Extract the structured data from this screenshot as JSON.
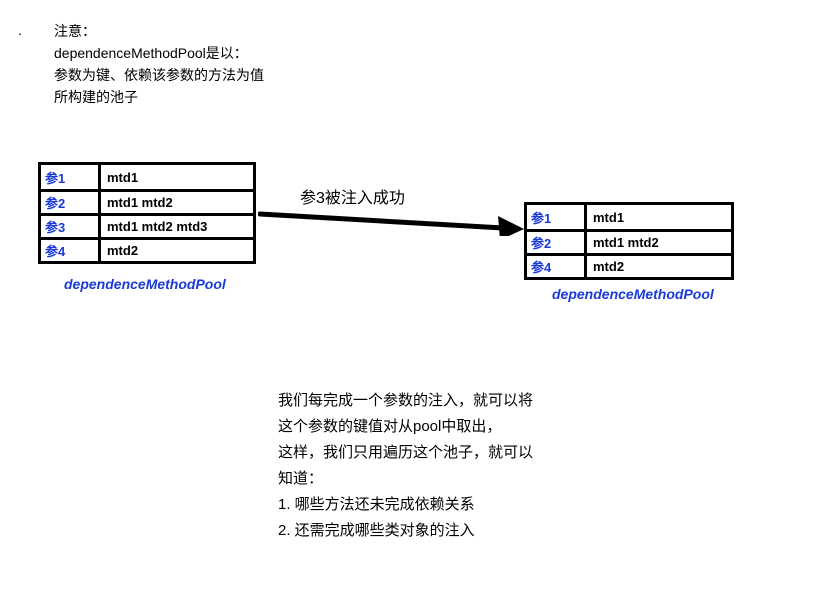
{
  "intro": {
    "line1": "注意：",
    "line2": "dependenceMethodPool是以：",
    "line3": "参数为键、依赖该参数的方法为值",
    "line4": "所构建的池子"
  },
  "leftTable": {
    "rows": [
      {
        "key": "参1",
        "val": "mtd1"
      },
      {
        "key": "参2",
        "val": "mtd1 mtd2"
      },
      {
        "key": "参3",
        "val": "mtd1 mtd2 mtd3"
      },
      {
        "key": "参4",
        "val": "mtd2"
      }
    ],
    "caption": "dependenceMethodPool"
  },
  "rightTable": {
    "rows": [
      {
        "key": "参1",
        "val": "mtd1"
      },
      {
        "key": "参2",
        "val": "mtd1 mtd2"
      },
      {
        "key": "参4",
        "val": "mtd2"
      }
    ],
    "caption": "dependenceMethodPool"
  },
  "arrowLabel": "参3被注入成功",
  "description": {
    "line1": "我们每完成一个参数的注入，就可以将",
    "line2": "这个参数的键值对从pool中取出，",
    "line3": "这样，我们只用遍历这个池子，就可以",
    "line4": "知道：",
    "line5": "1. 哪些方法还未完成依赖关系",
    "line6": "2. 还需完成哪些类对象的注入"
  }
}
